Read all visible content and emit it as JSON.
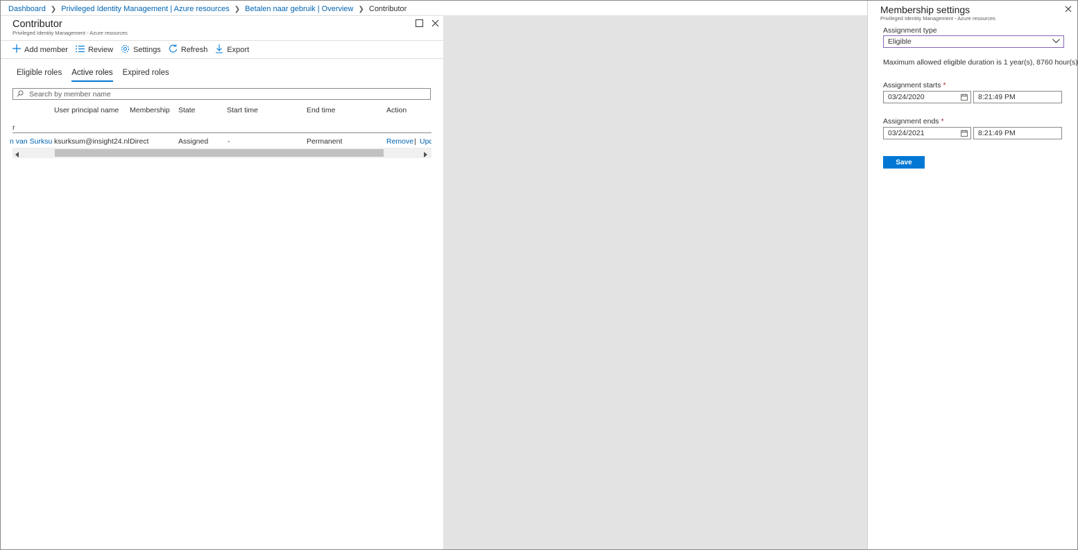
{
  "breadcrumb": {
    "items": [
      "Dashboard",
      "Privileged Identity Management | Azure resources",
      "Betalen naar gebruik | Overview"
    ],
    "current": "Contributor"
  },
  "blade": {
    "title": "Contributor",
    "subtitle": "Privileged Identity Management - Azure resources"
  },
  "toolbar": {
    "add_member": "Add member",
    "review": "Review",
    "settings": "Settings",
    "refresh": "Refresh",
    "export": "Export"
  },
  "tabs": {
    "eligible": "Eligible roles",
    "active": "Active roles",
    "expired": "Expired roles",
    "selected": "Active roles"
  },
  "search": {
    "placeholder": "Search by member name"
  },
  "table": {
    "headers": {
      "upn": "User principal name",
      "membership": "Membership",
      "state": "State",
      "start": "Start time",
      "end": "End time",
      "action": "Action"
    },
    "group_label": "r",
    "rows": [
      {
        "name": "n van Surksum",
        "upn": "ksurksum@insight24.nl",
        "membership": "Direct",
        "state": "Assigned",
        "start": "-",
        "end": "Permanent",
        "action_remove": "Remove",
        "action_sep": "|",
        "action_update": "Upd"
      }
    ]
  },
  "side_panel": {
    "title": "Membership settings",
    "subtitle": "Privileged Identity Management - Azure resources",
    "assignment_type_label": "Assignment type",
    "assignment_type_value": "Eligible",
    "info_text": "Maximum allowed eligible duration is 1 year(s), 8760 hour(s).",
    "starts_label": "Assignment starts",
    "starts_date": "03/24/2020",
    "starts_time": "8:21:49 PM",
    "ends_label": "Assignment ends",
    "ends_date": "03/24/2021",
    "ends_time": "8:21:49 PM",
    "required_mark": "*",
    "save_label": "Save"
  },
  "colors": {
    "accent": "#0078d4",
    "link": "#0063b1",
    "select_border": "#8764b8",
    "required": "#a4262c",
    "overlay": "#e3e3e3"
  }
}
